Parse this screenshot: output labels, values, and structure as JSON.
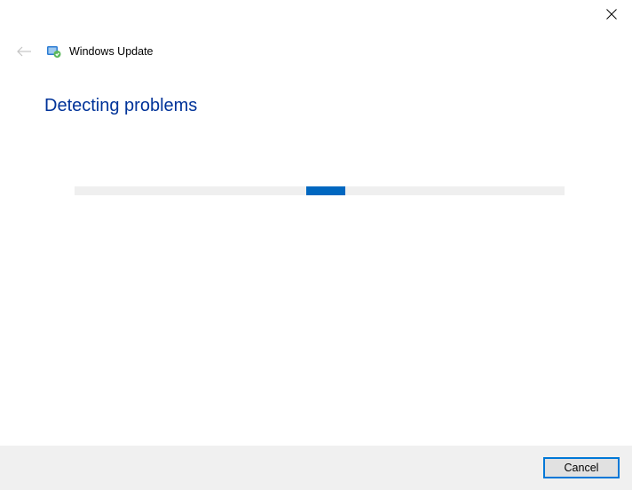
{
  "window": {
    "app_title": "Windows Update"
  },
  "main": {
    "heading": "Detecting problems"
  },
  "progress": {
    "indeterminate": true
  },
  "footer": {
    "cancel_label": "Cancel"
  },
  "colors": {
    "accent": "#0067c0",
    "heading": "#003399",
    "footer_bg": "#f0f0f0",
    "track": "#efefef"
  }
}
